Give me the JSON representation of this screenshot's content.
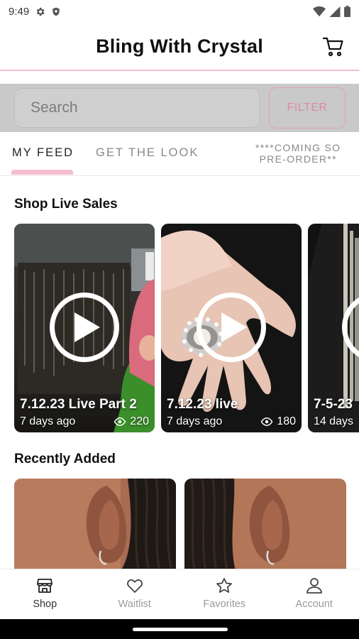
{
  "status_bar": {
    "time": "9:49"
  },
  "header": {
    "title": "Bling With Crystal"
  },
  "search": {
    "placeholder": "Search",
    "filter_label": "FILTER"
  },
  "tabs": [
    {
      "label": "MY FEED"
    },
    {
      "label": "GET THE LOOK"
    },
    {
      "label_line1": "****COMING SO",
      "label_line2": "PRE-ORDER**"
    }
  ],
  "live_section": {
    "title": "Shop Live Sales",
    "cards": [
      {
        "title": "7.12.23 Live Part 2",
        "age": "7 days ago",
        "views": "220"
      },
      {
        "title": "7.12.23 live",
        "age": "7 days ago",
        "views": "180"
      },
      {
        "title": "7-5-23",
        "age": "14 days",
        "views": ""
      }
    ]
  },
  "recent_section": {
    "title": "Recently Added"
  },
  "bottom_nav": [
    {
      "label": "Shop",
      "icon": "shop-icon"
    },
    {
      "label": "Waitlist",
      "icon": "heart-icon"
    },
    {
      "label": "Favorites",
      "icon": "star-icon"
    },
    {
      "label": "Account",
      "icon": "account-icon"
    }
  ],
  "colors": {
    "accent_pink": "#f6bcd0",
    "filter_pink": "#d98ca3",
    "divider_pink": "#f0bfd0"
  }
}
